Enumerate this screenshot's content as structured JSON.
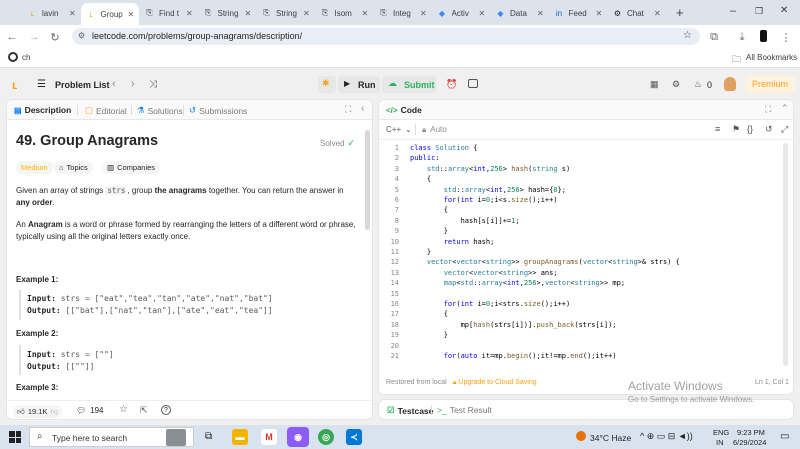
{
  "browser": {
    "tabs": [
      {
        "label": "lavin",
        "icon": "leetcode-icon",
        "active": false
      },
      {
        "label": "Group",
        "icon": "leetcode-icon",
        "active": true
      },
      {
        "label": "Find t",
        "icon": "doc-icon",
        "active": false
      },
      {
        "label": "String",
        "icon": "doc-icon",
        "active": false
      },
      {
        "label": "String",
        "icon": "doc-icon",
        "active": false
      },
      {
        "label": "Isom",
        "icon": "doc-icon",
        "active": false
      },
      {
        "label": "Integ",
        "icon": "doc-icon",
        "active": false
      },
      {
        "label": "Activ",
        "icon": "diamond-icon",
        "active": false
      },
      {
        "label": "Data",
        "icon": "diamond-icon",
        "active": false
      },
      {
        "label": "Feed",
        "icon": "linkedin-icon",
        "active": false
      },
      {
        "label": "Chat",
        "icon": "chatgpt-icon",
        "active": false
      }
    ],
    "url": "leetcode.com/problems/group-anagrams/description/",
    "bookmark_item": "ch",
    "all_bookmarks": "All Bookmarks"
  },
  "nav": {
    "problem_list": "Problem List",
    "run": "Run",
    "submit": "Submit",
    "fire_count": "0",
    "premium": "Premium"
  },
  "left": {
    "tabs": [
      "Description",
      "Editorial",
      "Solutions",
      "Submissions"
    ],
    "title": "49. Group Anagrams",
    "solved": "Solved",
    "difficulty": "Medium",
    "topics": "Topics",
    "companies": "Companies",
    "para1_a": "Given an array of strings ",
    "para1_code": "strs",
    "para1_b": ", group ",
    "para1_bold": "the anagrams",
    "para1_c": " together. You can return the answer in ",
    "para1_bold2": "any order",
    "para1_d": ".",
    "para2_bold": "Anagram",
    "para2_a": "An ",
    "para2_b": " is a word or phrase formed by rearranging the letters of a different word or phrase, typically using all the original letters exactly once.",
    "example1": "Example 1:",
    "ex1_input_label": "Input:",
    "ex1_input": "strs = [\"eat\",\"tea\",\"tan\",\"ate\",\"nat\",\"bat\"]",
    "ex1_output_label": "Output:",
    "ex1_output": "[[\"bat\"],[\"nat\",\"tan\"],[\"ate\",\"eat\",\"tea\"]]",
    "example2": "Example 2:",
    "ex2_input": "strs = [\"\"]",
    "ex2_output": "[[\"\"]]",
    "example3": "Example 3:",
    "likes": "19.1K",
    "comments": "194"
  },
  "right": {
    "code_tab": "Code",
    "language": "C++",
    "auto": "Auto",
    "restored": "Restored from local",
    "upgrade": "Upgrade to Cloud Saving",
    "cursor": "Ln 1, Col 1",
    "testcase": "Testcase",
    "test_result": "Test Result",
    "activate_title": "Activate Windows",
    "activate_sub": "Go to Settings to activate Windows."
  },
  "code": [
    "class Solution {",
    "public:",
    "    std::array<int,256> hash(string s)",
    "    {",
    "        std::array<int,256> hash={0};",
    "        for(int i=0;i<s.size();i++)",
    "        {",
    "            hash[s[i]]+=1;",
    "        }",
    "        return hash;",
    "    }",
    "    vector<vector<string>> groupAnagrams(vector<string>& strs) {",
    "        vector<vector<string>> ans;",
    "        map<std::array<int,256>,vector<string>> mp;",
    "",
    "        for(int i=0;i<strs.size();i++)",
    "        {",
    "            mp[hash(strs[i])].push_back(strs[i]);",
    "        }",
    "",
    "        for(auto it=mp.begin();it!=mp.end();it++)"
  ],
  "taskbar": {
    "search_placeholder": "Type here to search",
    "weather": "34°C  Haze",
    "lang": "ENG",
    "region": "IN",
    "time": "9:23 PM",
    "date": "6/29/2024"
  },
  "colors": {
    "accent": "#ffa116",
    "run": "#262626",
    "submit": "#2db55d",
    "link": "#007aff"
  }
}
